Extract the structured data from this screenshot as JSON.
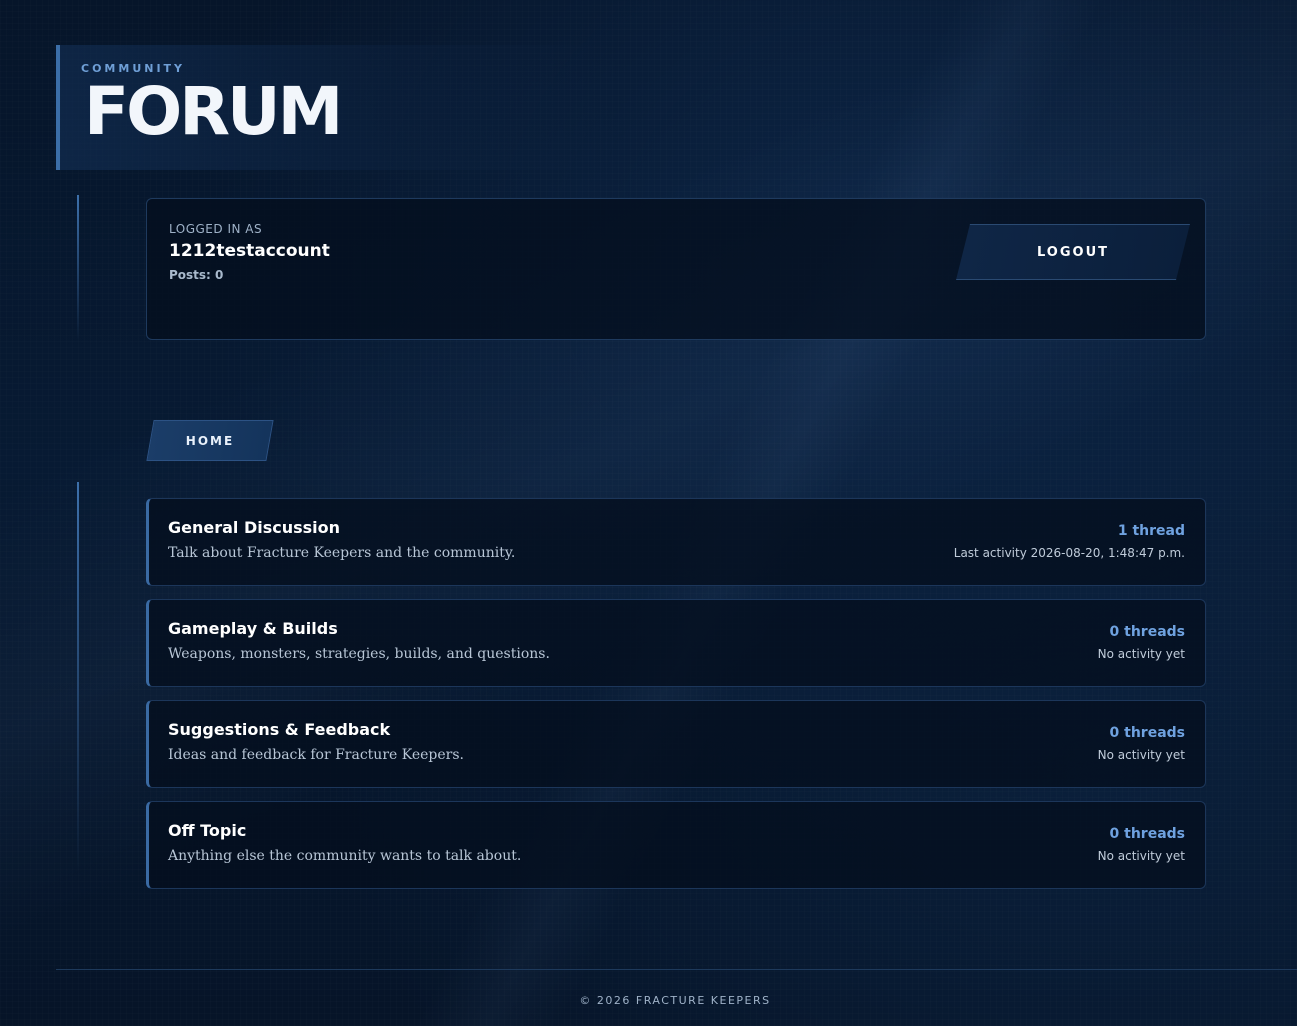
{
  "header": {
    "eyebrow": "COMMUNITY",
    "title": "FORUM"
  },
  "user_panel": {
    "logged_in_label": "LOGGED IN AS",
    "username": "1212testaccount",
    "posts": "Posts: 0",
    "logout_label": "LOGOUT"
  },
  "nav": {
    "home_label": "HOME"
  },
  "categories": [
    {
      "title": "General Discussion",
      "description": "Talk about Fracture Keepers and the community.",
      "count": "1 thread",
      "activity": "Last activity 2026-08-20, 1:48:47 p.m."
    },
    {
      "title": "Gameplay & Builds",
      "description": "Weapons, monsters, strategies, builds, and questions.",
      "count": "0 threads",
      "activity": "No activity yet"
    },
    {
      "title": "Suggestions & Feedback",
      "description": "Ideas and feedback for Fracture Keepers.",
      "count": "0 threads",
      "activity": "No activity yet"
    },
    {
      "title": "Off Topic",
      "description": "Anything else the community wants to talk about.",
      "count": "0 threads",
      "activity": "No activity yet"
    }
  ],
  "footer": {
    "text": "© 2026 FRACTURE KEEPERS"
  },
  "colors": {
    "background": "#061326",
    "accent": "#3b6ea8",
    "count_text": "#6fa2e0"
  }
}
